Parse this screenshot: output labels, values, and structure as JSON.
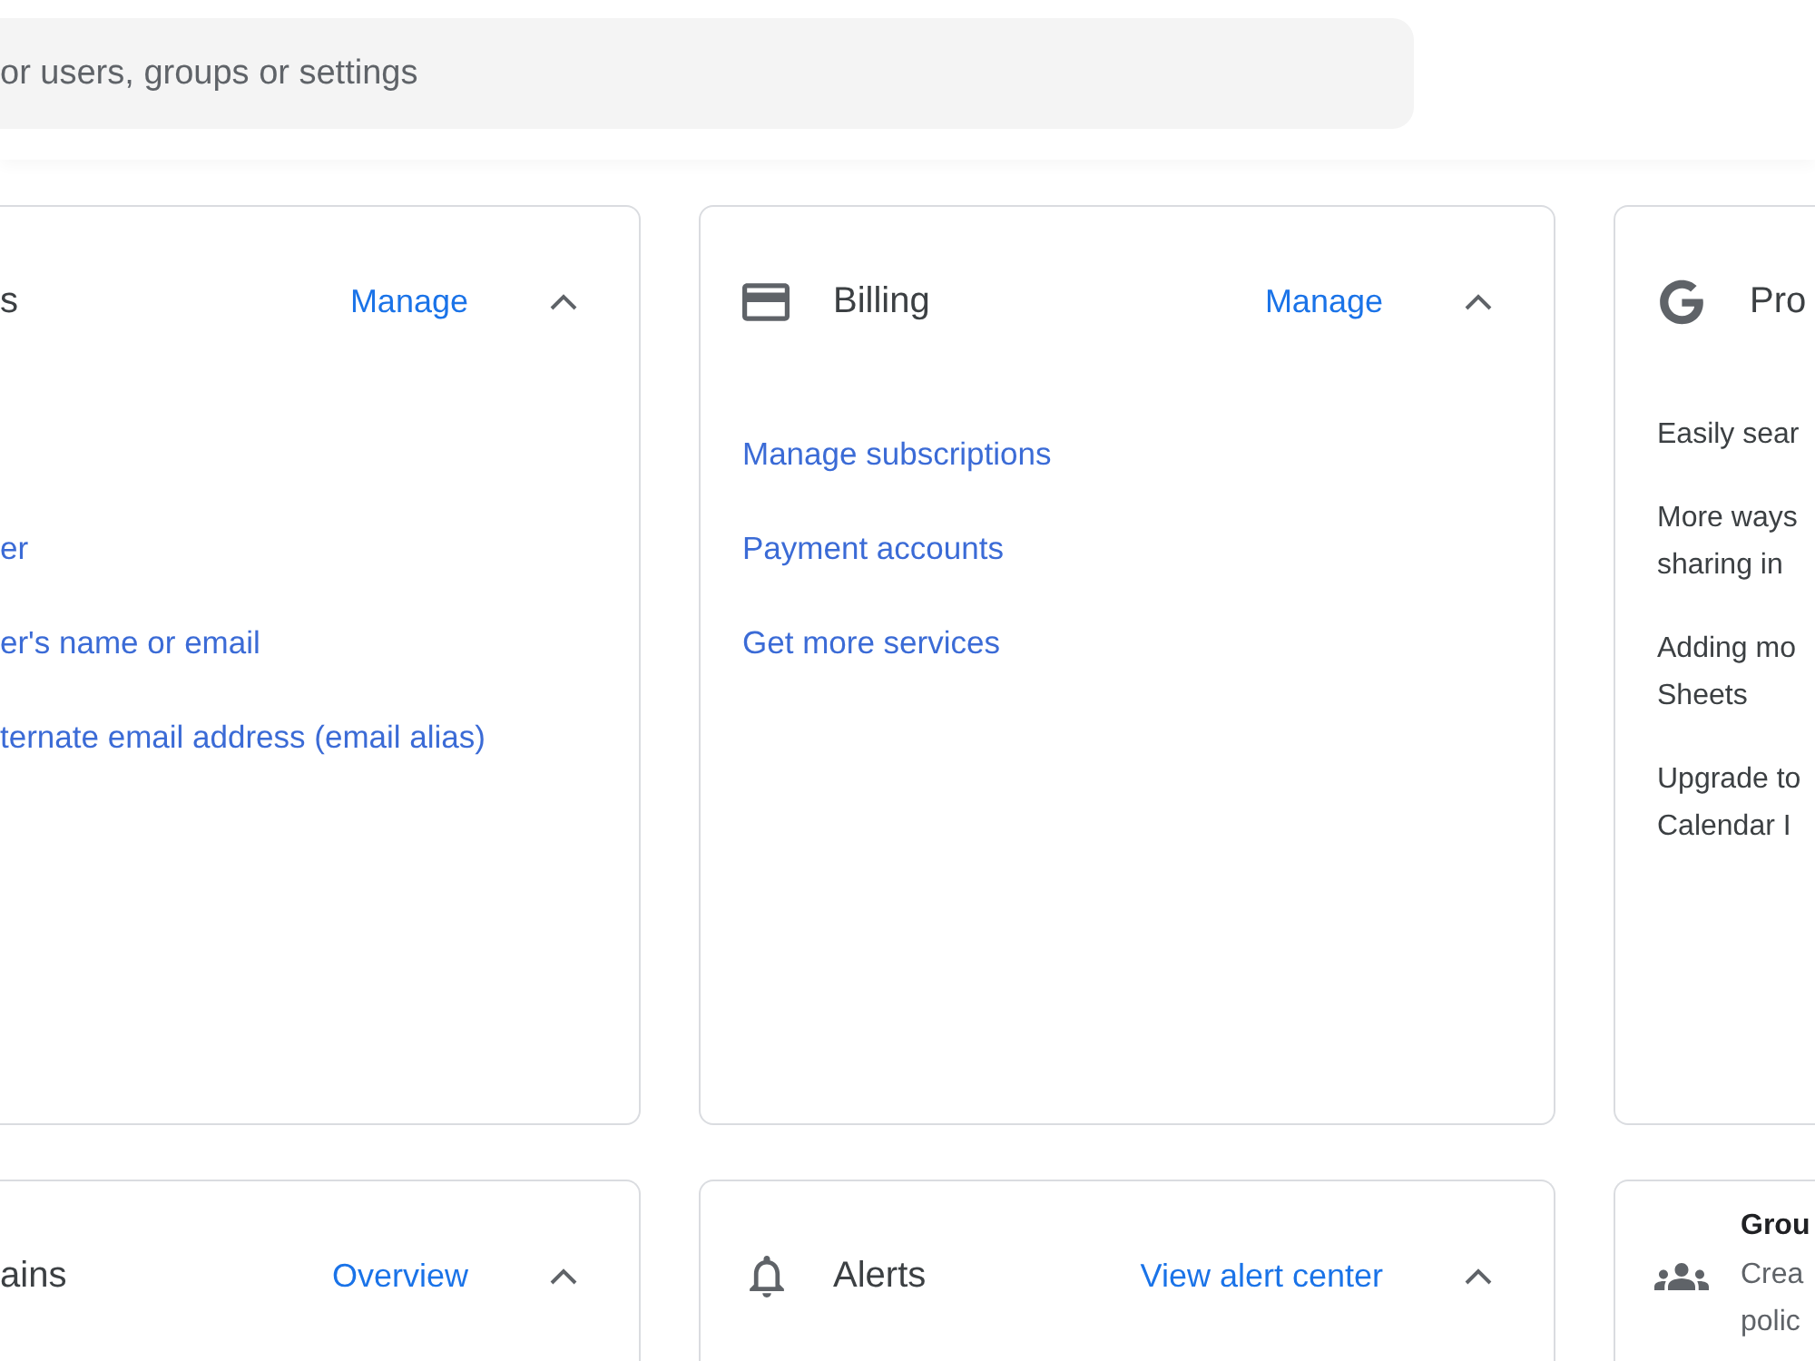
{
  "search": {
    "placeholder": "or users, groups or settings"
  },
  "rows": [
    {
      "cards": [
        {
          "kind": "panel",
          "title": "s",
          "action": "Manage",
          "expanded": true,
          "links": [
            "er",
            "er's name or email",
            "ternate email address (email alias)"
          ]
        },
        {
          "kind": "panel",
          "title": "Billing",
          "action": "Manage",
          "expanded": true,
          "links": [
            "Manage subscriptions",
            "Payment accounts",
            "Get more services"
          ]
        },
        {
          "kind": "news",
          "title": "Pro",
          "items": [
            {
              "lines": [
                "Easily sear"
              ]
            },
            {
              "lines": [
                "More ways",
                "sharing in"
              ]
            },
            {
              "lines": [
                "Adding mo",
                "Sheets"
              ]
            },
            {
              "lines": [
                "Upgrade to",
                "Calendar I"
              ]
            }
          ]
        }
      ]
    },
    {
      "cards": [
        {
          "kind": "panel",
          "title": "ains",
          "action": "Overview",
          "expanded": true
        },
        {
          "kind": "panel",
          "title": "Alerts",
          "action": "View alert center",
          "expanded": true
        },
        {
          "kind": "feature",
          "title": "Grou",
          "lines": [
            "Crea",
            "polic"
          ]
        }
      ]
    }
  ]
}
